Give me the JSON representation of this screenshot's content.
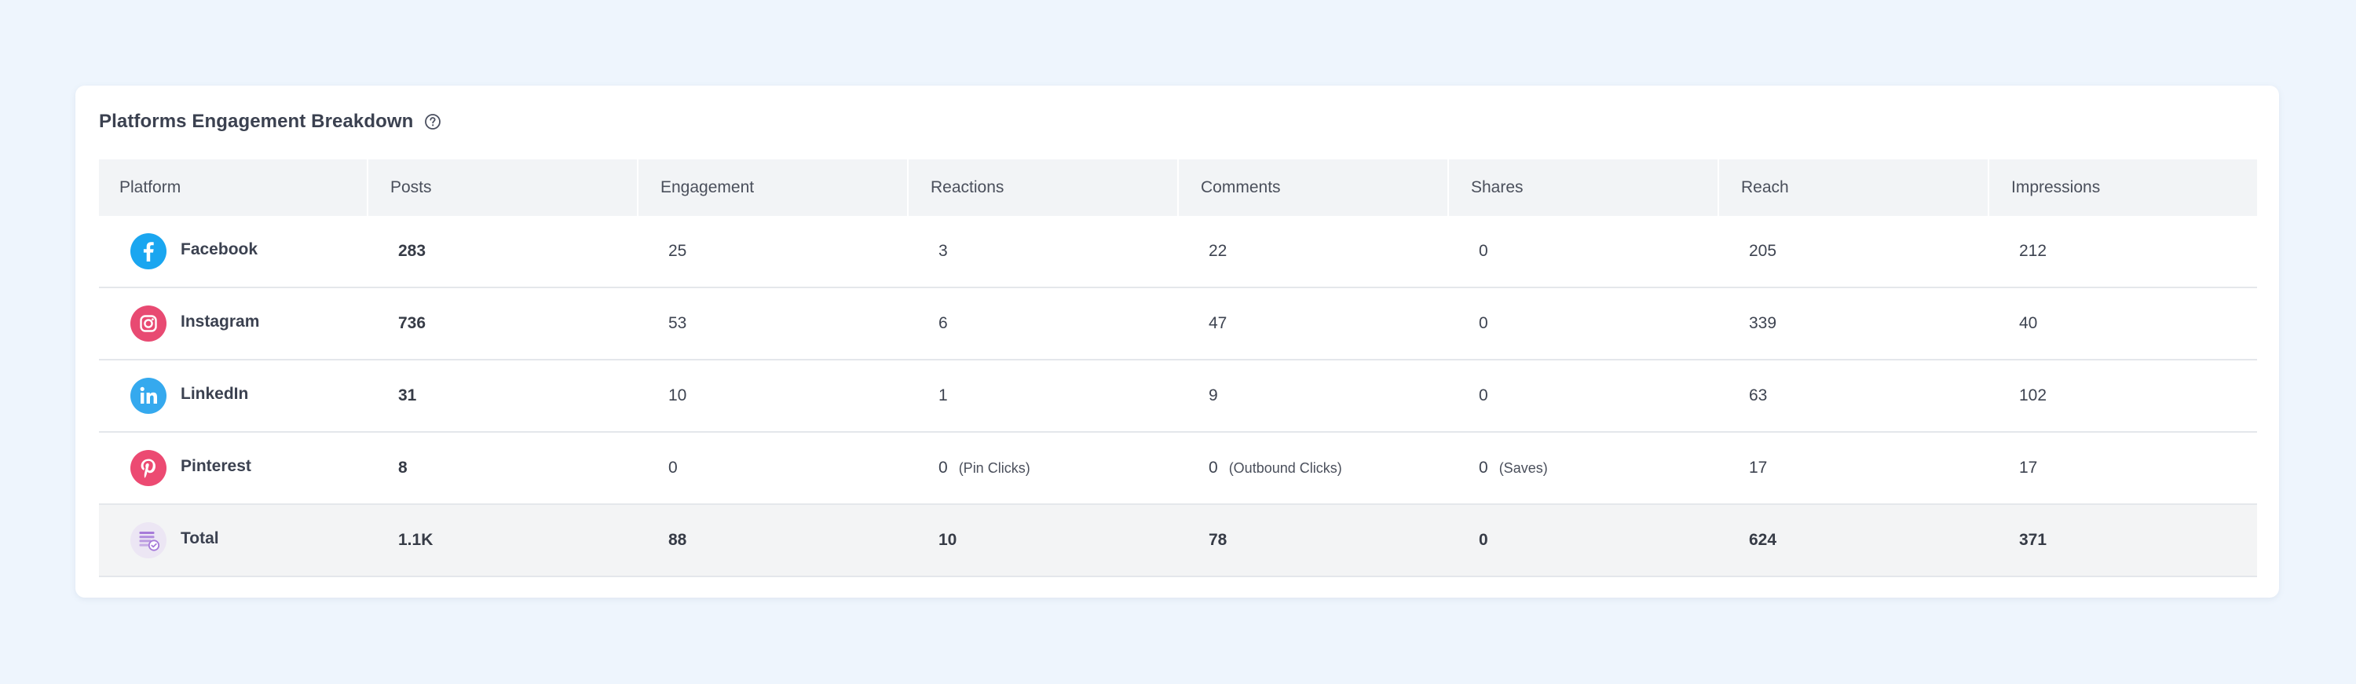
{
  "card": {
    "title": "Platforms Engagement Breakdown"
  },
  "table": {
    "columns": [
      "Platform",
      "Posts",
      "Engagement",
      "Reactions",
      "Comments",
      "Shares",
      "Reach",
      "Impressions"
    ],
    "rows": [
      {
        "platform": "Facebook",
        "icon": "facebook-icon",
        "color": "#1aa6f0",
        "posts": "283",
        "engagement": "25",
        "reactions": "3",
        "reactions_note": "",
        "comments": "22",
        "comments_note": "",
        "shares": "0",
        "shares_note": "",
        "reach": "205",
        "impressions": "212"
      },
      {
        "platform": "Instagram",
        "icon": "instagram-icon",
        "color": "#e84a72",
        "posts": "736",
        "engagement": "53",
        "reactions": "6",
        "reactions_note": "",
        "comments": "47",
        "comments_note": "",
        "shares": "0",
        "shares_note": "",
        "reach": "339",
        "impressions": "40"
      },
      {
        "platform": "LinkedIn",
        "icon": "linkedin-icon",
        "color": "#35a9ee",
        "posts": "31",
        "engagement": "10",
        "reactions": "1",
        "reactions_note": "",
        "comments": "9",
        "comments_note": "",
        "shares": "0",
        "shares_note": "",
        "reach": "63",
        "impressions": "102"
      },
      {
        "platform": "Pinterest",
        "icon": "pinterest-icon",
        "color": "#ec4a72",
        "posts": "8",
        "engagement": "0",
        "reactions": "0",
        "reactions_note": "(Pin Clicks)",
        "comments": "0",
        "comments_note": "(Outbound Clicks)",
        "shares": "0",
        "shares_note": "(Saves)",
        "reach": "17",
        "impressions": "17"
      }
    ],
    "total": {
      "platform": "Total",
      "icon": "total-stack-icon",
      "color": "#a77bd9",
      "posts": "1.1K",
      "engagement": "88",
      "reactions": "10",
      "comments": "78",
      "shares": "0",
      "reach": "624",
      "impressions": "371"
    }
  }
}
